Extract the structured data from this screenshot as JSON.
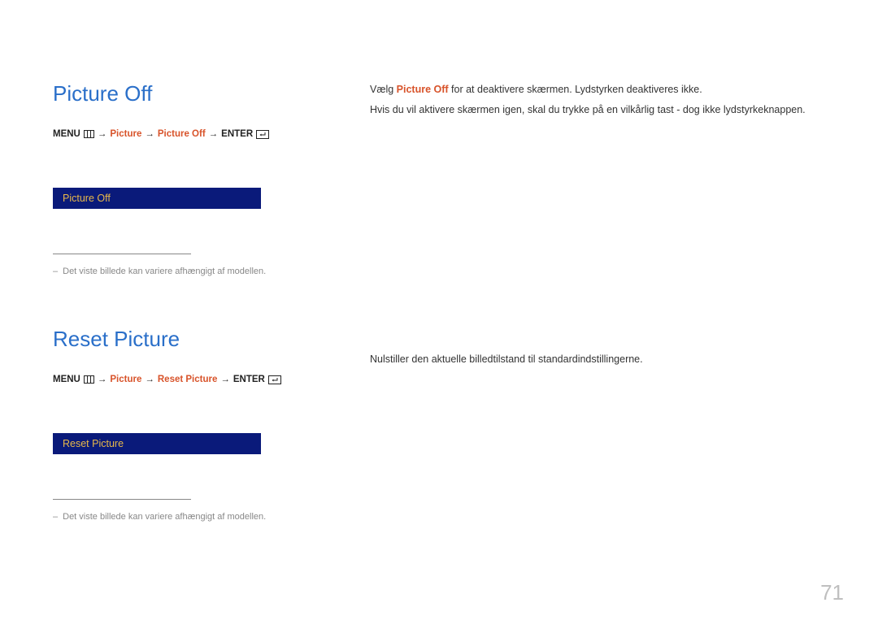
{
  "section1": {
    "heading": "Picture Off",
    "breadcrumb": {
      "menu": "MENU",
      "step1": "Picture",
      "step2": "Picture Off",
      "enter": "ENTER",
      "arrow": "→"
    },
    "ui_label": "Picture Off",
    "note": "Det viste billede kan variere afhængigt af modellen.",
    "description": {
      "pre": "Vælg ",
      "accent": "Picture Off",
      "post": " for at deaktivere skærmen. Lydstyrken deaktiveres ikke.",
      "line2": "Hvis du vil aktivere skærmen igen, skal du trykke på en vilkårlig tast - dog ikke lydstyrkeknappen."
    }
  },
  "section2": {
    "heading": "Reset Picture",
    "breadcrumb": {
      "menu": "MENU",
      "step1": "Picture",
      "step2": "Reset Picture",
      "enter": "ENTER",
      "arrow": "→"
    },
    "ui_label": "Reset Picture",
    "note": "Det viste billede kan variere afhængigt af modellen.",
    "description": "Nulstiller den aktuelle billedtilstand til standardindstillingerne."
  },
  "page_number": "71",
  "dash": "–"
}
